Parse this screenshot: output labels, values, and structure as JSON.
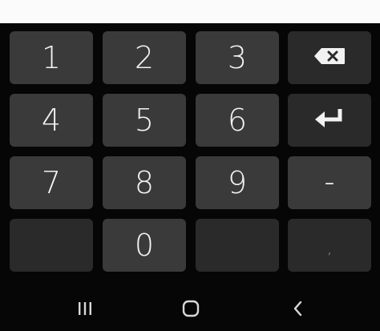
{
  "keypad": {
    "rows": [
      [
        {
          "label": "1",
          "name": "key-1"
        },
        {
          "label": "2",
          "name": "key-2"
        },
        {
          "label": "3",
          "name": "key-3"
        }
      ],
      [
        {
          "label": "4",
          "name": "key-4"
        },
        {
          "label": "5",
          "name": "key-5"
        },
        {
          "label": "6",
          "name": "key-6"
        }
      ],
      [
        {
          "label": "7",
          "name": "key-7"
        },
        {
          "label": "8",
          "name": "key-8"
        },
        {
          "label": "9",
          "name": "key-9"
        }
      ],
      [
        {
          "label": "",
          "name": "key-blank-left"
        },
        {
          "label": "0",
          "name": "key-0"
        },
        {
          "label": "",
          "name": "key-blank-right"
        }
      ]
    ],
    "side": {
      "backspace_icon": "backspace-icon",
      "enter_icon": "enter-icon",
      "dash_label": "–",
      "comma_label": ","
    }
  },
  "navbar": {
    "recents_icon": "recents-icon",
    "home_icon": "home-icon",
    "back_icon": "back-icon"
  },
  "colors": {
    "background": "#060606",
    "key_light": "#3a3a3a",
    "key_dark": "#2a2a2a",
    "text": "#f2f2f2",
    "top_strip": "#fbfbfb"
  }
}
